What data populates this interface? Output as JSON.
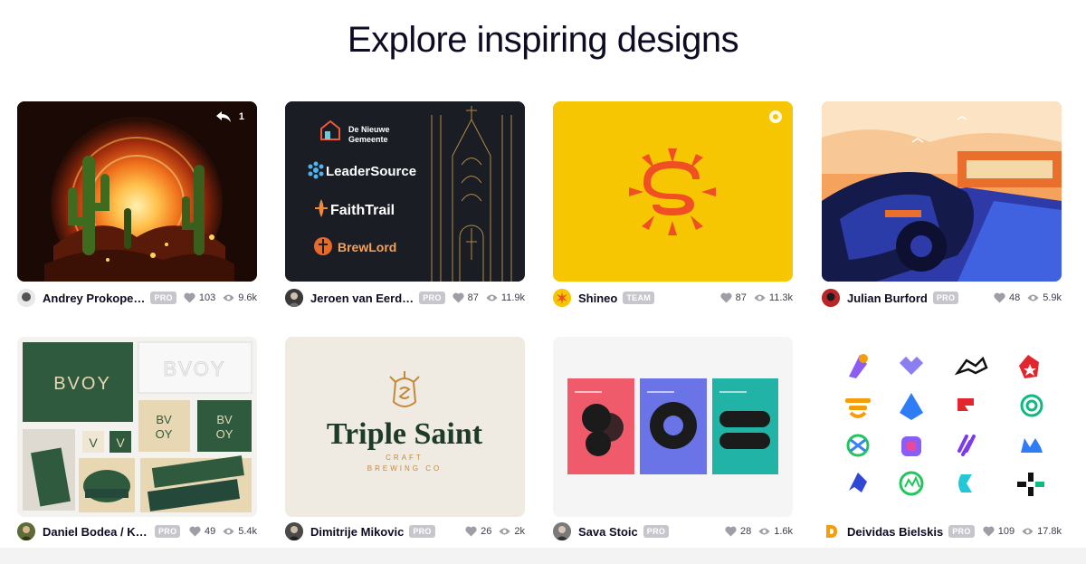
{
  "page": {
    "title": "Explore inspiring designs"
  },
  "shots": [
    {
      "author": "Andrey Prokopenk...",
      "badge": "PRO",
      "likes": "103",
      "views": "9.6k",
      "share_count": "1"
    },
    {
      "author": "Jeroen van Eerden",
      "badge": "PRO",
      "likes": "87",
      "views": "11.9k",
      "logos": [
        "De Nieuwe",
        "Gemeente",
        "LeaderSource",
        "FaithTrail",
        "BrewLord"
      ]
    },
    {
      "author": "Shineo",
      "badge": "TEAM",
      "likes": "87",
      "views": "11.3k"
    },
    {
      "author": "Julian Burford",
      "badge": "PRO",
      "likes": "48",
      "views": "5.9k"
    },
    {
      "author": "Daniel Bodea / Kre...",
      "badge": "PRO",
      "likes": "49",
      "views": "5.4k",
      "brand": "BVOY",
      "brand_split_top": "BV",
      "brand_split_bottom": "OY",
      "brand_mark": "V"
    },
    {
      "author": "Dimitrije Mikovic",
      "badge": "PRO",
      "likes": "26",
      "views": "2k",
      "wordmark": "Triple Saint",
      "wordmark_sub1": "CRAFT",
      "wordmark_sub2": "BREWING CO"
    },
    {
      "author": "Sava Stoic",
      "badge": "PRO",
      "likes": "28",
      "views": "1.6k"
    },
    {
      "author": "Deividas Bielskis",
      "badge": "PRO",
      "likes": "109",
      "views": "17.8k"
    }
  ],
  "icons": {
    "like": "heart-icon",
    "views": "eye-icon",
    "share": "reply-arrow-icon"
  },
  "colors": {
    "badge": "#c6c6cc",
    "text": "#0d0c22",
    "shineo_yellow": "#f7c602",
    "shineo_orange": "#f04e23",
    "bvoy_green": "#2f5a3e"
  }
}
